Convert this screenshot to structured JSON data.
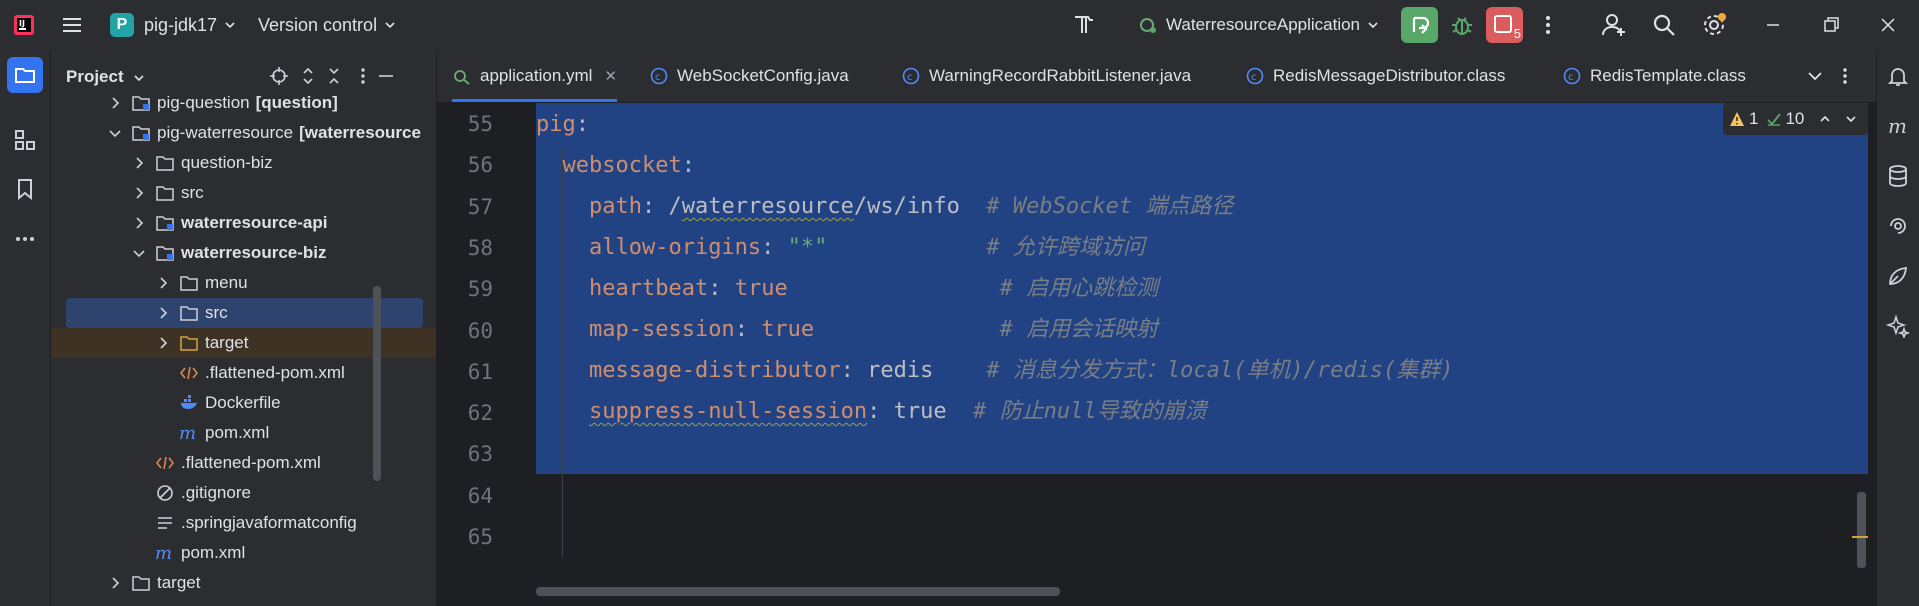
{
  "titlebar": {
    "project_badge": "P",
    "project_name": "pig-jdk17",
    "vcs_label": "Version control",
    "run_config": "WaterresourceApplication",
    "stop_badge": "5"
  },
  "project_panel": {
    "title": "Project",
    "tree": [
      {
        "label": "pig-question",
        "suffix": "[question]",
        "icon": "module-folder-icon",
        "chevron": "right"
      },
      {
        "label": "pig-waterresource",
        "suffix": "[waterresource",
        "icon": "module-folder-icon",
        "chevron": "down"
      },
      {
        "label": "question-biz",
        "suffix": "",
        "icon": "folder-icon",
        "chevron": "right"
      },
      {
        "label": "src",
        "suffix": "",
        "icon": "folder-icon",
        "chevron": "right"
      },
      {
        "label": "waterresource-api",
        "suffix": "",
        "icon": "module-folder-icon",
        "chevron": "right"
      },
      {
        "label": "waterresource-biz",
        "suffix": "",
        "icon": "module-folder-icon",
        "chevron": "down"
      },
      {
        "label": "menu",
        "suffix": "",
        "icon": "folder-icon",
        "chevron": "right"
      },
      {
        "label": "src",
        "suffix": "",
        "icon": "folder-icon",
        "chevron": "right"
      },
      {
        "label": "target",
        "suffix": "",
        "icon": "excluded-folder-icon",
        "chevron": "right"
      },
      {
        "label": ".flattened-pom.xml",
        "suffix": "",
        "icon": "xml-file-icon",
        "chevron": ""
      },
      {
        "label": "Dockerfile",
        "suffix": "",
        "icon": "docker-icon",
        "chevron": ""
      },
      {
        "label": "pom.xml",
        "suffix": "",
        "icon": "maven-icon",
        "chevron": ""
      },
      {
        "label": ".flattened-pom.xml",
        "suffix": "",
        "icon": "xml-file-icon",
        "chevron": ""
      },
      {
        "label": ".gitignore",
        "suffix": "",
        "icon": "ignore-file-icon",
        "chevron": ""
      },
      {
        "label": ".springjavaformatconfig",
        "suffix": "",
        "icon": "text-file-icon",
        "chevron": ""
      },
      {
        "label": "pom.xml",
        "suffix": "",
        "icon": "maven-icon",
        "chevron": ""
      },
      {
        "label": "target",
        "suffix": "",
        "icon": "folder-icon",
        "chevron": "right"
      }
    ]
  },
  "tabs": [
    {
      "label": "application.yml",
      "icon": "yaml-icon",
      "active": true
    },
    {
      "label": "WebSocketConfig.java",
      "icon": "class-icon",
      "active": false
    },
    {
      "label": "WarningRecordRabbitListener.java",
      "icon": "class-icon",
      "active": false
    },
    {
      "label": "RedisMessageDistributor.class",
      "icon": "class-icon",
      "active": false
    },
    {
      "label": "RedisTemplate.class",
      "icon": "class-icon",
      "active": false
    }
  ],
  "editor": {
    "line_numbers": [
      "55",
      "56",
      "57",
      "58",
      "59",
      "60",
      "61",
      "62",
      "63",
      "64",
      "65"
    ],
    "lines": {
      "l55": {
        "key": "pig",
        "sep": ":"
      },
      "l56": {
        "key": "websocket",
        "sep": ":"
      },
      "l57": {
        "key": "path",
        "sep": ": ",
        "value_pre": "/",
        "value_wavy": "waterresource",
        "value_post": "/ws/info",
        "comment": "# WebSocket 端点路径"
      },
      "l58": {
        "key": "allow-origins",
        "sep": ": ",
        "value": "\"*\"",
        "comment": "# 允许跨域访问"
      },
      "l59": {
        "key": "heartbeat",
        "sep": ": ",
        "value": "true",
        "comment": "# 启用心跳检测"
      },
      "l60": {
        "key": "map-session",
        "sep": ": ",
        "value": "true",
        "comment": "# 启用会话映射"
      },
      "l61": {
        "key": "message-distributor",
        "sep": ": ",
        "value": "redis",
        "comment": "# 消息分发方式：local(单机)/redis(集群)"
      },
      "l62": {
        "key": "suppress-null-session",
        "sep": ": ",
        "value": "true",
        "comment": "# 防止null导致的崩溃"
      }
    },
    "inspections": {
      "warnings": "1",
      "weak_warnings": "10"
    }
  },
  "colors": {
    "accent": "#3574f0",
    "selection": "#214283",
    "yaml_key": "#cf8e6d",
    "string": "#6aab73",
    "comment": "#7a7e85",
    "run_button": "#59a869",
    "stop_button": "#db5c5c"
  }
}
